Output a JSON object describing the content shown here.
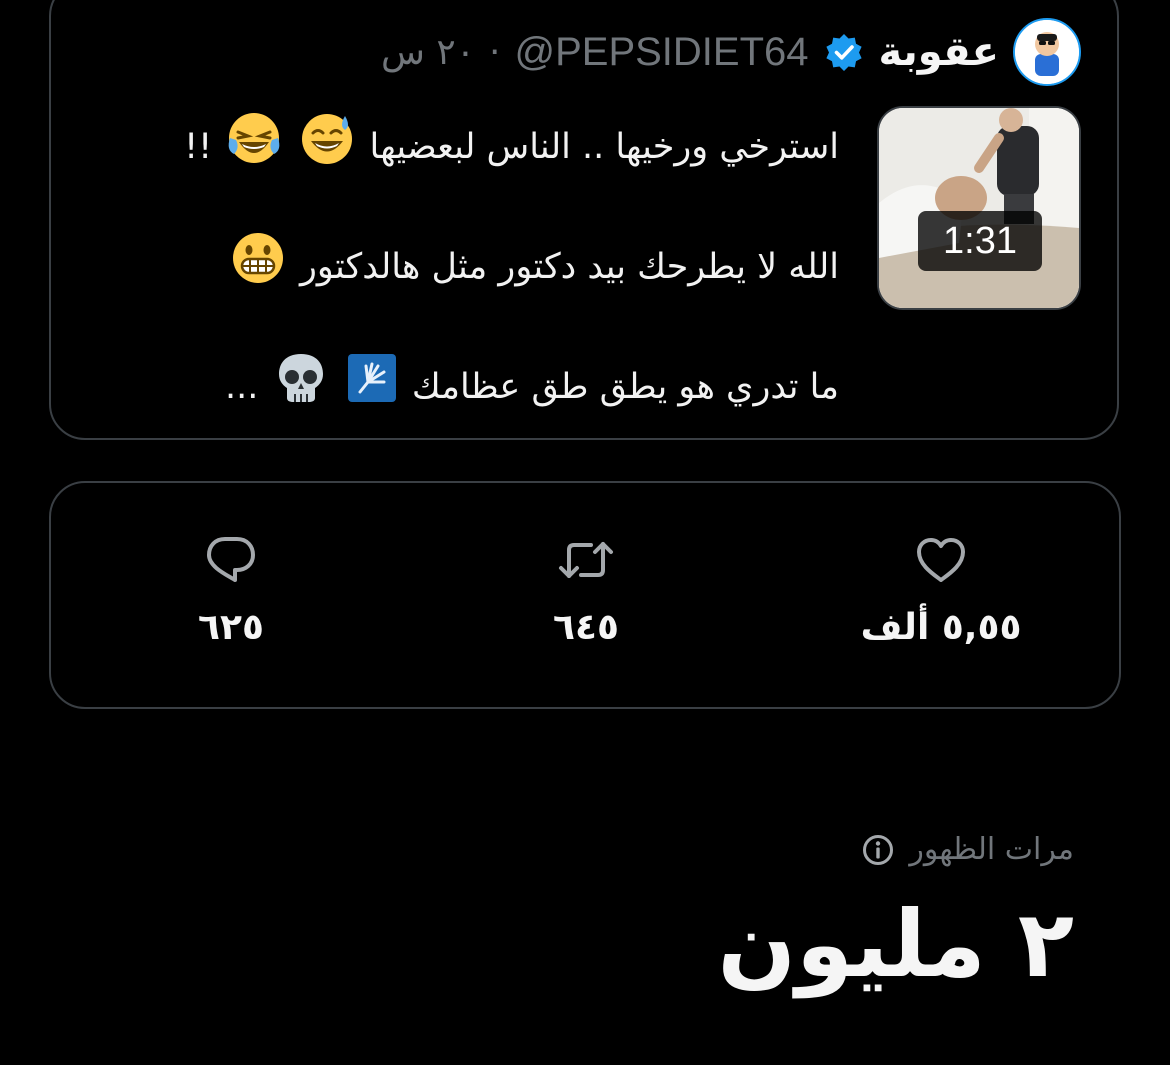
{
  "tweet": {
    "display_name": "عقوبة",
    "handle": "@PEPSIDIET64",
    "separator": "·",
    "time": "٢٠ س",
    "video_duration": "1:31",
    "lines": [
      "استرخي ورخيها .. الناس لبعضيها",
      "الله لا يطرحك بيد دكتور مثل هالدكتور",
      "ما تدري هو يطق طق عظامك"
    ],
    "line_suffixes": [
      "!!",
      "",
      "..."
    ],
    "emoji": {
      "line1": [
        "sweat-smile-emoji",
        "tears-of-joy-emoji"
      ],
      "line2": [
        "grimacing-emoji"
      ],
      "line3": [
        "xray-emoji",
        "skull-emoji"
      ]
    }
  },
  "stats": {
    "replies": "٦٢٥",
    "retweets": "٦٤٥",
    "likes": "٥,٥٥ ألف"
  },
  "impressions": {
    "label": "مرات الظهور",
    "value": "٢ مليون"
  },
  "colors": {
    "background": "#000000",
    "border": "#3a3f44",
    "text": "#e7e9ea",
    "muted": "#71767b",
    "verified": "#1d9bf0"
  }
}
